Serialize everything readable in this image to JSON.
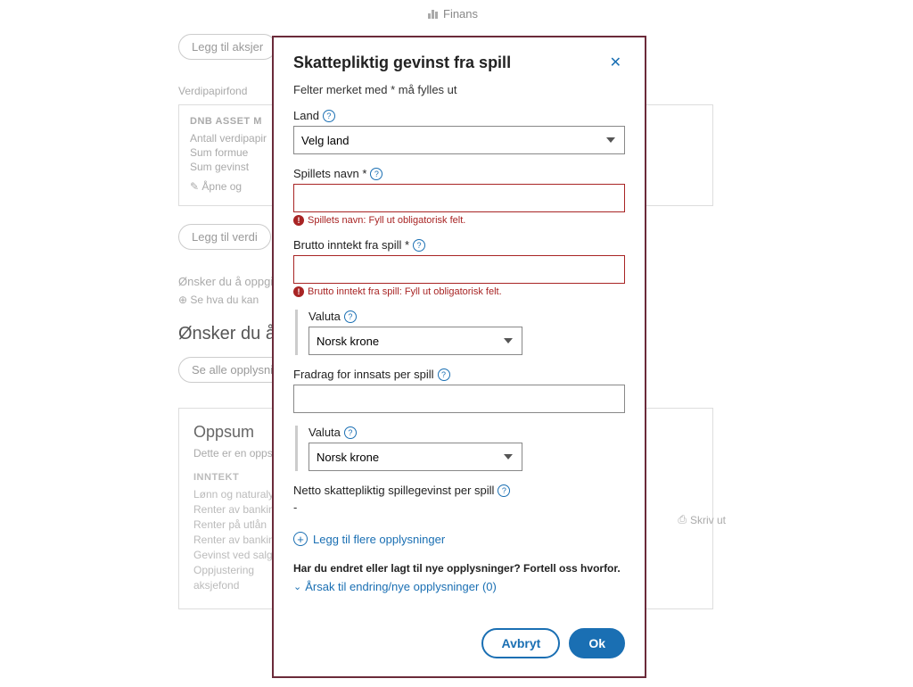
{
  "header": {
    "tab": "Finans"
  },
  "bg": {
    "pill1": "Legg til aksjer",
    "section1": "Verdipapirfond",
    "card_title": "DNB ASSET M",
    "card1": "Antall verdipapir",
    "card2": "Sum formue",
    "card3": "Sum gevinst",
    "card_action": "Åpne og",
    "pill2": "Legg til verdi",
    "q1": "Ønsker du å oppgi",
    "hint1": "Se hva du kan",
    "q2": "Ønsker du å",
    "pill3": "Se alle opplysninger",
    "summary_title": "Oppsum",
    "summary_text": "Dette er en oppsummering av skattemelding",
    "summary_sub": "INNTEKT",
    "li1": "Lønn og naturalytelser",
    "li2": "Renter av bankinnskudd",
    "li3": "Renter på utlån",
    "li4": "Renter av bankinnskudd",
    "li5": "Gevinst ved salg",
    "li6": "Oppjustering",
    "li7": "aksjefond",
    "print": "Skriv ut"
  },
  "modal": {
    "title": "Skattepliktig gevinst fra spill",
    "help": "Felter merket med * må fylles ut",
    "land_label": "Land",
    "land_value": "Velg land",
    "navn_label": "Spillets navn *",
    "navn_err": "Spillets navn: Fyll ut obligatorisk felt.",
    "brutto_label": "Brutto inntekt fra spill *",
    "brutto_err": "Brutto inntekt fra spill: Fyll ut obligatorisk felt.",
    "valuta_label": "Valuta",
    "valuta_value": "Norsk krone",
    "fradrag_label": "Fradrag for innsats per spill",
    "netto_label": "Netto skattepliktig spillegevinst per spill",
    "netto_value": "-",
    "add": "Legg til flere opplysninger",
    "question": "Har du endret eller lagt til nye opplysninger? Fortell oss hvorfor.",
    "reason": "Årsak til endring/nye opplysninger (0)",
    "cancel": "Avbryt",
    "ok": "Ok"
  }
}
